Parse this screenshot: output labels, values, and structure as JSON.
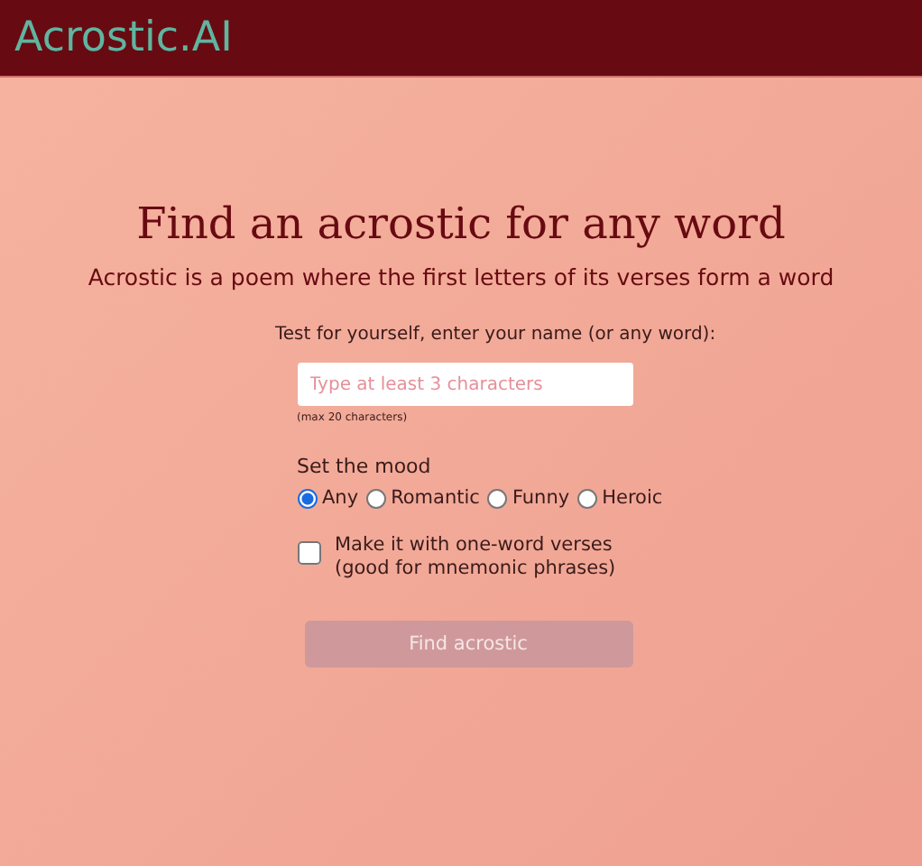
{
  "header": {
    "logo": "Acrostic.AI"
  },
  "heading": "Find an acrostic for any word",
  "subheading": "Acrostic is a poem where the first letters of its verses form a word",
  "form": {
    "prompt": "Test for yourself, enter your name (or any word):",
    "name_field": {
      "placeholder": "Type at least 3 characters"
    },
    "hint": "(max 20 characters)",
    "mood_label": "Set the mood",
    "moods": [
      {
        "label": "Any",
        "selected": true
      },
      {
        "label": "Romantic",
        "selected": false
      },
      {
        "label": "Funny",
        "selected": false
      },
      {
        "label": "Heroic",
        "selected": false
      }
    ],
    "one_word": {
      "checked": false,
      "lines": [
        "Make it with one-word verses",
        "(good for mnemonic phrases)"
      ]
    },
    "submit": {
      "label": "Find acrostic",
      "disabled": true
    }
  }
}
